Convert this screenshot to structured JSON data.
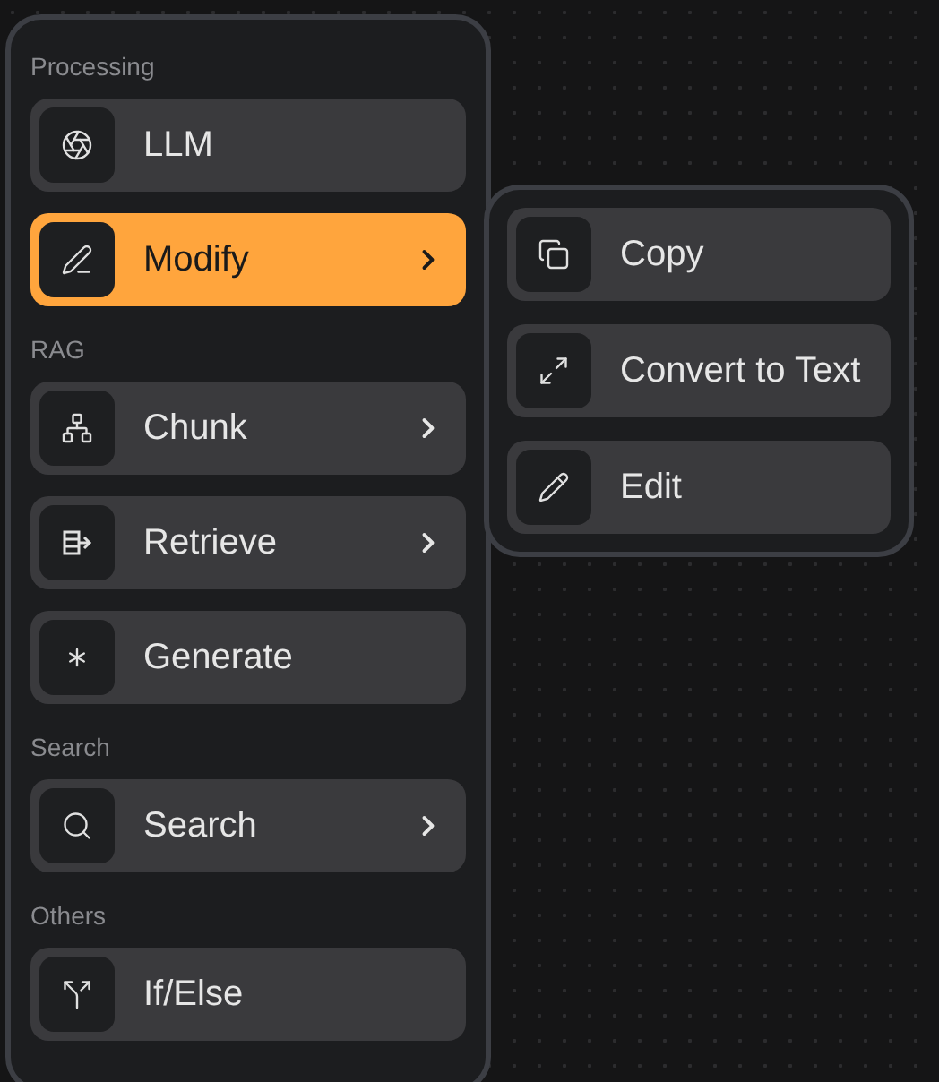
{
  "menu": {
    "sections": [
      {
        "title": "Processing",
        "items": [
          {
            "label": "LLM",
            "selected": false,
            "submenu": false
          },
          {
            "label": "Modify",
            "selected": true,
            "submenu": true
          }
        ]
      },
      {
        "title": "RAG",
        "items": [
          {
            "label": "Chunk",
            "selected": false,
            "submenu": true
          },
          {
            "label": "Retrieve",
            "selected": false,
            "submenu": true
          },
          {
            "label": "Generate",
            "selected": false,
            "submenu": false
          }
        ]
      },
      {
        "title": "Search",
        "items": [
          {
            "label": "Search",
            "selected": false,
            "submenu": true
          }
        ]
      },
      {
        "title": "Others",
        "items": [
          {
            "label": "If/Else",
            "selected": false,
            "submenu": false
          }
        ]
      }
    ]
  },
  "submenu": {
    "items": [
      {
        "label": "Copy"
      },
      {
        "label": "Convert to Text"
      },
      {
        "label": "Edit"
      }
    ]
  }
}
